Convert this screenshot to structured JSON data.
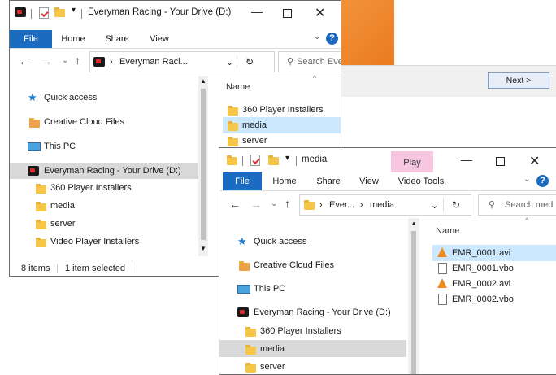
{
  "background": {
    "next_button_label": "Next >"
  },
  "window1": {
    "title": "Everyman Racing - Your Drive (D:)",
    "ribbon_tabs": [
      "File",
      "Home",
      "Share",
      "View"
    ],
    "address_path": "Everyman Raci...",
    "search_placeholder": "Search Ever",
    "column_header": "Name",
    "nav_items": [
      "Quick access",
      "Creative Cloud Files",
      "This PC",
      "Everyman Racing - Your Drive (D:)",
      "360 Player Installers",
      "media",
      "server",
      "Video Player Installers"
    ],
    "files": [
      "360 Player Installers",
      "media",
      "server"
    ],
    "status_count": "8 items",
    "status_selected": "1 item selected"
  },
  "window2": {
    "title": "media",
    "context_tab": "Play",
    "ribbon_tabs": [
      "File",
      "Home",
      "Share",
      "View",
      "Video Tools"
    ],
    "address_seg1": "Ever...",
    "address_seg2": "media",
    "search_placeholder": "Search med",
    "column_header": "Name",
    "nav_items": [
      "Quick access",
      "Creative Cloud Files",
      "This PC",
      "Everyman Racing - Your Drive (D:)",
      "360 Player Installers",
      "media",
      "server"
    ],
    "files": [
      "EMR_0001.avi",
      "EMR_0001.vbo",
      "EMR_0002.avi",
      "EMR_0002.vbo"
    ]
  },
  "colors": {
    "accent": "#1b6cc1",
    "selection": "#cce8ff",
    "nav_selection": "#d9d9d9",
    "context_tab": "#f7c6e0",
    "orange_bg": "#f08a2b"
  }
}
